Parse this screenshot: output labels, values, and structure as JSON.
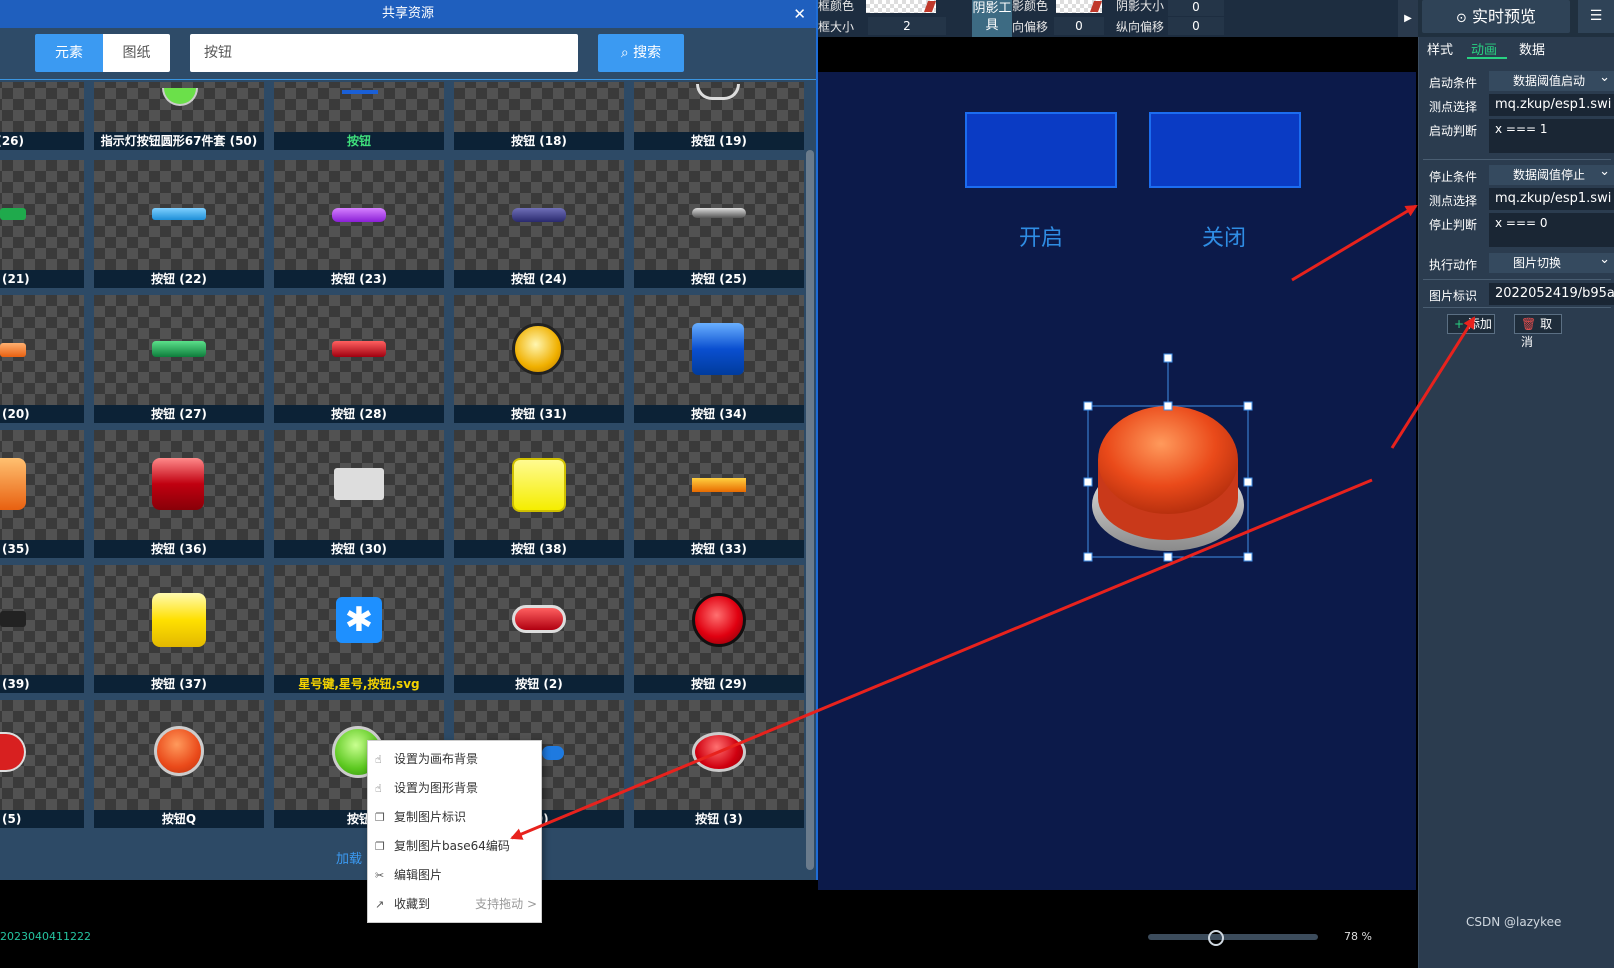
{
  "toolbar": {
    "border_color_label": "框颜色",
    "border_size_label": "框大小",
    "border_size_value": "2",
    "shadow_tool_label": "阴影工具",
    "shadow_color_label": "阴影颜色",
    "shadow_size_label": "阴影大小",
    "shadow_size_value": "0",
    "h_offset_label": "横向偏移",
    "h_offset_value": "0",
    "v_offset_label": "纵向偏移",
    "v_offset_value": "0",
    "collapse_icon": "▶"
  },
  "right_panel": {
    "preview_label": "实时预览",
    "tabs": [
      "样式",
      "动画",
      "数据"
    ],
    "active_tab": "动画",
    "start_condition_label": "启动条件",
    "start_condition_value": "数据阈值启动",
    "point_select_label": "测点选择",
    "point_select_value": "mq.zkup/esp1.swi",
    "start_judge_label": "启动判断",
    "start_judge_value": "x === 1",
    "stop_condition_label": "停止条件",
    "stop_condition_value": "数据阈值停止",
    "point_select2_label": "测点选择",
    "point_select2_value": "mq.zkup/esp1.swi",
    "stop_judge_label": "停止判断",
    "stop_judge_value": "x === 0",
    "action_label": "执行动作",
    "action_value": "图片切换",
    "image_id_label": "图片标识",
    "image_id_value": "2022052419/b95a",
    "add_label": "添加",
    "cancel_label": "取消"
  },
  "canvas": {
    "open_label": "开启",
    "close_label": "关闭"
  },
  "dialog": {
    "title": "共享资源",
    "tab_elements": "元素",
    "tab_drawings": "图纸",
    "search_value": "按钮",
    "search_button": "搜索",
    "load_more": "加载",
    "items": [
      [
        "(26)",
        "指示灯按钮圆形67件套 (50)",
        "按钮",
        "按钮 (18)",
        "按钮 (19)"
      ],
      [
        "(21)",
        "按钮 (22)",
        "按钮 (23)",
        "按钮 (24)",
        "按钮 (25)"
      ],
      [
        "(20)",
        "按钮 (27)",
        "按钮 (28)",
        "按钮 (31)",
        "按钮 (34)"
      ],
      [
        "(35)",
        "按钮 (36)",
        "按钮 (30)",
        "按钮 (38)",
        "按钮 (33)"
      ],
      [
        "(39)",
        "按钮 (37)",
        "星号键,星号,按钮,svg",
        "按钮 (2)",
        "按钮 (29)"
      ],
      [
        "(5)",
        "按钮Q",
        "按钮",
        "(9)",
        "按钮 (3)"
      ]
    ]
  },
  "context_menu": {
    "items": [
      "设置为画布背景",
      "设置为图形背景",
      "复制图片标识",
      "复制图片base64编码",
      "编辑图片",
      "收藏到"
    ],
    "drag_hint": "支持拖动 >"
  },
  "status": {
    "id_text": "2023040411222",
    "zoom": "78 %",
    "watermark": "CSDN @lazykee"
  },
  "colors": {
    "accent": "#3b9af2",
    "active_tab": "#29d182",
    "canvas_bg": "#0c1a4a",
    "arrow": "#e8221d"
  }
}
